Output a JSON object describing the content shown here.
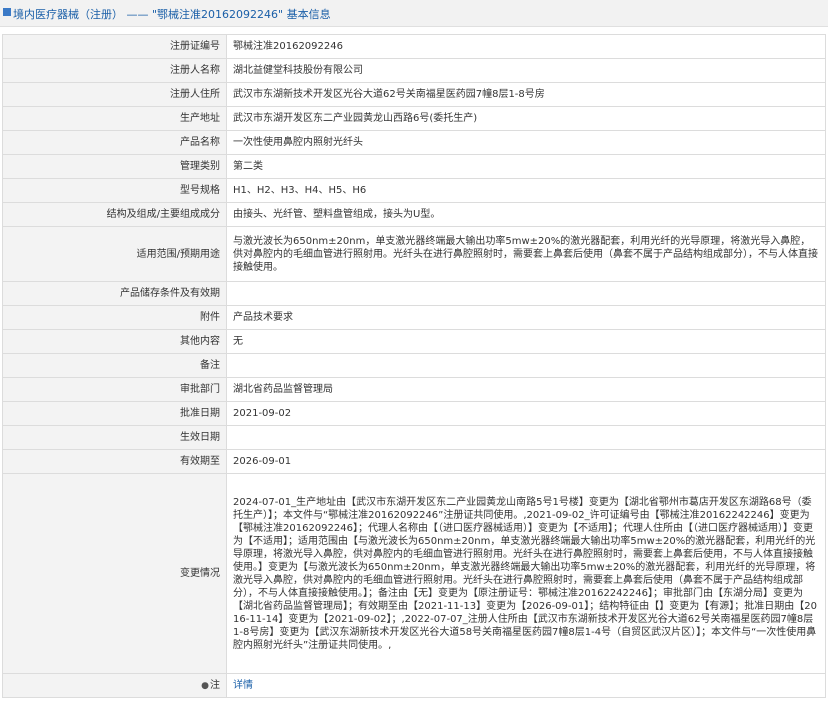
{
  "header": {
    "title": "境内医疗器械（注册） —— \"鄂械注准20162092246\" 基本信息"
  },
  "rows": [
    {
      "label": "注册证编号",
      "value": "鄂械注准20162092246"
    },
    {
      "label": "注册人名称",
      "value": "湖北益健堂科技股份有限公司"
    },
    {
      "label": "注册人住所",
      "value": "武汉市东湖新技术开发区光谷大道62号关南福星医药园7幢8层1-8号房"
    },
    {
      "label": "生产地址",
      "value": "武汉市东湖开发区东二产业园黄龙山西路6号(委托生产)"
    },
    {
      "label": "产品名称",
      "value": "一次性使用鼻腔内照射光纤头"
    },
    {
      "label": "管理类别",
      "value": "第二类"
    },
    {
      "label": "型号规格",
      "value": "H1、H2、H3、H4、H5、H6"
    },
    {
      "label": "结构及组成/主要组成成分",
      "value": "由接头、光纤管、塑料盘管组成，接头为U型。"
    },
    {
      "label": "适用范围/预期用途",
      "value": "与激光波长为650nm±20nm，单支激光器终端最大输出功率5mw±20%的激光器配套，利用光纤的光导原理，将激光导入鼻腔，供对鼻腔内的毛细血管进行照射用。光纤头在进行鼻腔照射时，需要套上鼻套后使用（鼻套不属于产品结构组成部分），不与人体直接接触使用。"
    },
    {
      "label": "产品储存条件及有效期",
      "value": ""
    },
    {
      "label": "附件",
      "value": "产品技术要求"
    },
    {
      "label": "其他内容",
      "value": "无"
    },
    {
      "label": "备注",
      "value": ""
    },
    {
      "label": "审批部门",
      "value": "湖北省药品监督管理局"
    },
    {
      "label": "批准日期",
      "value": "2021-09-02"
    },
    {
      "label": "生效日期",
      "value": ""
    },
    {
      "label": "有效期至",
      "value": "2026-09-01"
    },
    {
      "label": "变更情况",
      "value": "2024-07-01_生产地址由【武汉市东湖开发区东二产业园黄龙山南路5号1号楼】变更为【湖北省鄂州市葛店开发区东湖路68号（委托生产）】；本文件与“鄂械注准20162092246”注册证共同使用。,2021-09-02_许可证编号由【鄂械注准20162242246】变更为【鄂械注准20162092246】；代理人名称由【（进口医疗器械适用）】变更为【不适用】；代理人住所由【（进口医疗器械适用）】变更为【不适用】；适用范围由【与激光波长为650nm±20nm，单支激光器终端最大输出功率5mw±20%的激光器配套，利用光纤的光导原理，将激光导入鼻腔，供对鼻腔内的毛细血管进行照射用。光纤头在进行鼻腔照射时，需要套上鼻套后使用，不与人体直接接触使用。】变更为【与激光波长为650nm±20nm，单支激光器终端最大输出功率5mw±20%的激光器配套，利用光纤的光导原理，将激光导入鼻腔，供对鼻腔内的毛细血管进行照射用。光纤头在进行鼻腔照射时，需要套上鼻套后使用（鼻套不属于产品结构组成部分），不与人体直接接触使用。】；备注由【无】变更为【原注册证号：鄂械注准20162242246】；审批部门由【东湖分局】变更为【湖北省药品监督管理局】；有效期至由【2021-11-13】变更为【2026-09-01】；结构特征由【】变更为【有源】；批准日期由【2016-11-14】变更为【2021-09-02】；,2022-07-07_注册人住所由【武汉市东湖新技术开发区光谷大道62号关南福星医药园7幢8层1-8号房】变更为【武汉东湖新技术开发区光谷大道58号关南福星医药园7幢8层1-4号（自贸区武汉片区）】；本文件与“一次性使用鼻腔内照射光纤头”注册证共同使用。,"
    },
    {
      "label": "注",
      "value": "详情"
    }
  ]
}
